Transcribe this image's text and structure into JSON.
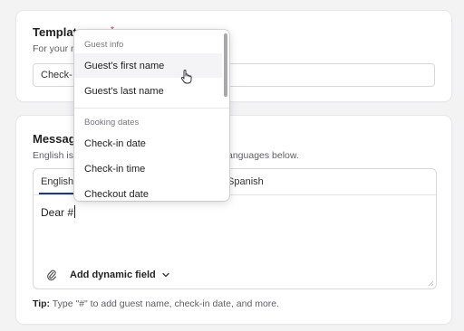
{
  "template_card": {
    "title": "Template",
    "required_mark": "*",
    "subtitle": "For your r",
    "input_value": "Check-"
  },
  "message_card": {
    "title": "Message",
    "subtitle_left": "English is",
    "subtitle_right": "anguages below.",
    "tabs": [
      {
        "label": "English",
        "active": true
      },
      {
        "label": "Spanish",
        "active": false
      }
    ],
    "editor_text": "Dear #",
    "add_field_label": "Add dynamic field",
    "tip_label": "Tip:",
    "tip_text": " Type \"#\" to add guest name, check-in date, and more."
  },
  "dropdown": {
    "groups": [
      {
        "label": "Guest info",
        "items": [
          "Guest's first name",
          "Guest's last name"
        ]
      },
      {
        "label": "Booking dates",
        "items": [
          "Check-in date",
          "Check-in time",
          "Checkout date"
        ]
      }
    ],
    "hovered_item": "Guest's first name"
  },
  "colors": {
    "accent": "#1c3a7a",
    "background": "#f3f3f4",
    "required": "#dd3333"
  }
}
